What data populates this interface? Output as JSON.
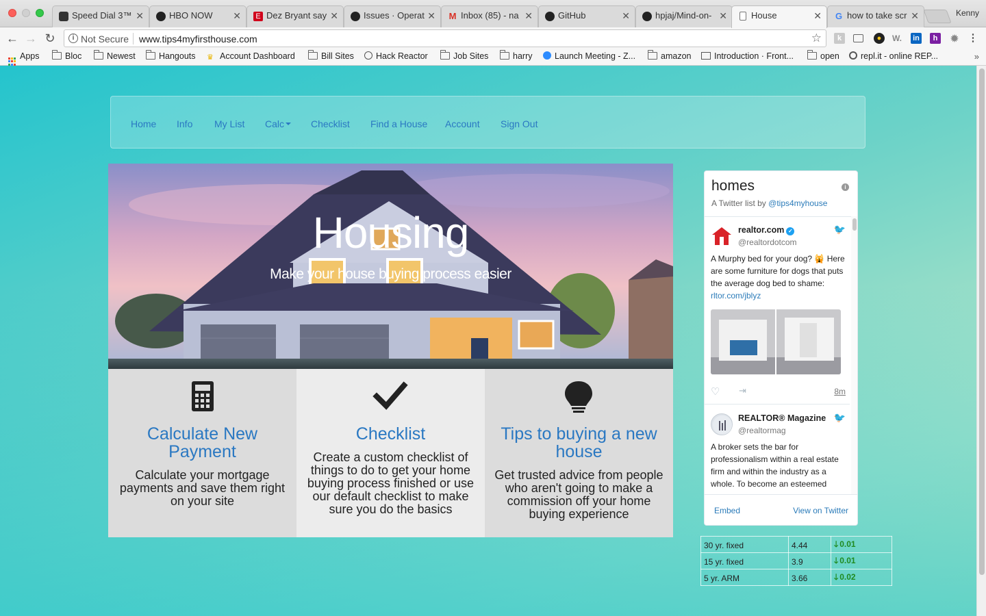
{
  "browser": {
    "tabs": [
      {
        "title": "Speed Dial 3™",
        "favicon": "speed-dial-icon"
      },
      {
        "title": "HBO NOW",
        "favicon": "hbo-icon"
      },
      {
        "title": "Dez Bryant say",
        "favicon": "espn-icon"
      },
      {
        "title": "Issues · Operat",
        "favicon": "github-icon"
      },
      {
        "title": "Inbox (85) - na",
        "favicon": "gmail-icon"
      },
      {
        "title": "GitHub",
        "favicon": "github-icon"
      },
      {
        "title": "hpjaj/Mind-on-",
        "favicon": "github-icon"
      },
      {
        "title": "House",
        "favicon": "page-icon",
        "active": true
      },
      {
        "title": "how to take scr",
        "favicon": "google-icon"
      }
    ],
    "profile_name": "Kenny",
    "security_label": "Not Secure",
    "url": "www.tips4myfirsthouse.com",
    "bookmarks": [
      {
        "label": "Apps",
        "icon": "apps-grid-icon"
      },
      {
        "label": "Bloc",
        "icon": "folder-icon"
      },
      {
        "label": "Newest",
        "icon": "folder-icon"
      },
      {
        "label": "Hangouts",
        "icon": "folder-icon"
      },
      {
        "label": "Account Dashboard",
        "icon": "crown-icon"
      },
      {
        "label": "Bill Sites",
        "icon": "folder-icon"
      },
      {
        "label": "Hack Reactor",
        "icon": "hack-reactor-icon"
      },
      {
        "label": "Job Sites",
        "icon": "folder-icon"
      },
      {
        "label": "harry",
        "icon": "folder-icon"
      },
      {
        "label": "Launch Meeting - Z...",
        "icon": "zoom-icon"
      },
      {
        "label": "amazon",
        "icon": "folder-icon"
      },
      {
        "label": "Introduction · Front...",
        "icon": "book-icon"
      },
      {
        "label": "open",
        "icon": "folder-icon"
      },
      {
        "label": "repl.it - online REP...",
        "icon": "replit-icon"
      }
    ]
  },
  "site": {
    "nav": [
      {
        "label": "Home"
      },
      {
        "label": "Info"
      },
      {
        "label": "My List"
      },
      {
        "label": "Calc",
        "dropdown": true
      },
      {
        "label": "Checklist"
      },
      {
        "label": "Find a House"
      },
      {
        "label": "Account"
      },
      {
        "label": "Sign Out"
      }
    ],
    "hero": {
      "title": "Housing",
      "subtitle": "Make your house buying process easier"
    },
    "features": [
      {
        "icon": "calculator-icon",
        "title": "Calculate New Payment",
        "text": "Calculate your mortgage payments and save them right on your site"
      },
      {
        "icon": "checkmark-icon",
        "title": "Checklist",
        "text": "Create a custom checklist of things to do to get your home buying process finished or use our default checklist to make sure you do the basics"
      },
      {
        "icon": "lightbulb-icon",
        "title": "Tips to buying a new house",
        "text": "Get trusted advice from people who aren't going to make a commission off your home buying experience"
      }
    ],
    "twitter": {
      "title": "homes",
      "subtitle_prefix": "A Twitter list by ",
      "subtitle_handle": "@tips4myhouse",
      "tweets": [
        {
          "name": "realtor.com",
          "handle": "@realtordotcom",
          "verified": true,
          "text": "A Murphy bed for your dog? 🙀 Here are some furniture for dogs that puts the average dog bed to shame: ",
          "link": "rltor.com/jblyz",
          "time": "8m"
        },
        {
          "name": "REALTOR® Magazine",
          "handle": "@realtormag",
          "verified": false,
          "text": "A broker sets the bar for professionalism within a real estate firm and within the industry as a whole. To become an esteemed",
          "link": "",
          "time": ""
        }
      ],
      "embed_label": "Embed",
      "view_label": "View on Twitter"
    },
    "rates": [
      {
        "product": "30 yr. fixed",
        "rate": "4.44",
        "change": "0.01",
        "direction": "down"
      },
      {
        "product": "15 yr. fixed",
        "rate": "3.9",
        "change": "0.01",
        "direction": "down"
      },
      {
        "product": "5 yr. ARM",
        "rate": "3.66",
        "change": "0.02",
        "direction": "down"
      }
    ]
  },
  "colors": {
    "link_blue": "#2a78c2",
    "twitter_blue": "#2b7bb9",
    "rate_green": "#1f8a1f",
    "page_teal": "#24c4cd",
    "feature_gray": "#dcdcdc",
    "feature_light": "#ececec"
  }
}
